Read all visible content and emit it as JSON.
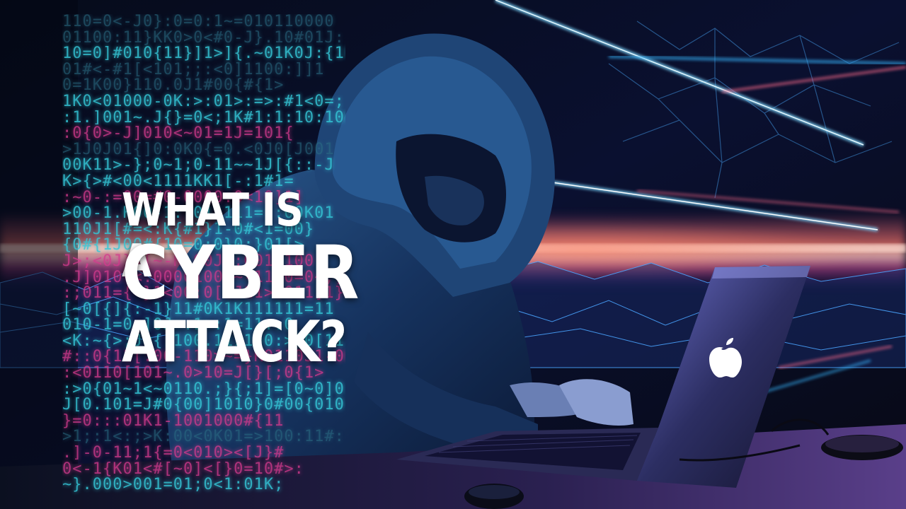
{
  "headline": {
    "line1": "WHAT IS A",
    "line2": "CYBER",
    "line3": "ATTACK?"
  },
  "scene": {
    "subject": "hooded-figure-icon",
    "device": "laptop-icon",
    "logo": "apple-logo-icon",
    "peripheral": "computer-mouse-icon"
  },
  "colors": {
    "background": "#050914",
    "neon_blue": "#39b7ff",
    "neon_pink": "#ff4f8a",
    "code_cyan": "#35c8d8",
    "code_pink": "#d43a8e",
    "headline": "#ffffff"
  }
}
